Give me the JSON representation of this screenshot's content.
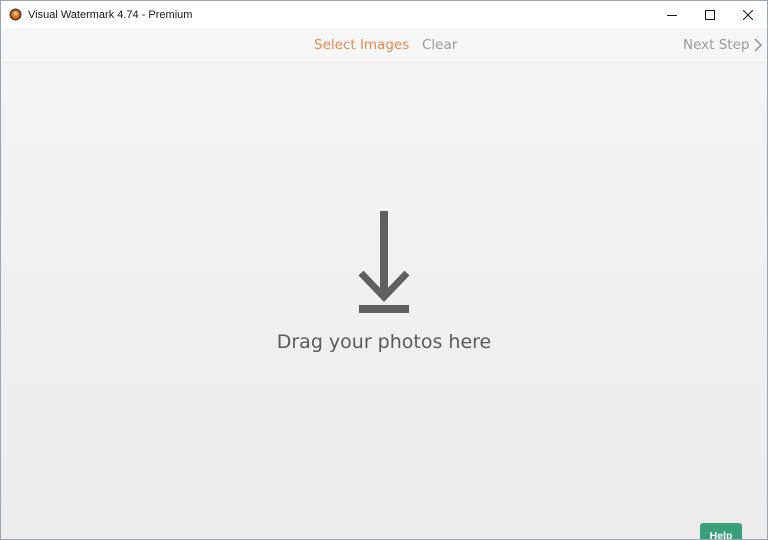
{
  "window": {
    "title": "Visual Watermark 4.74 - Premium",
    "controls": {
      "minimize": "minimize-icon",
      "maximize": "maximize-icon",
      "close": "close-icon"
    }
  },
  "toolbar": {
    "select_images": "Select Images",
    "clear": "Clear",
    "next_step": "Next Step"
  },
  "dropzone": {
    "label": "Drag your photos here",
    "icon": "download-arrow-icon"
  },
  "help": {
    "label": "Help"
  },
  "colors": {
    "accent": "#e58a4e",
    "muted": "#9a9a9a",
    "help_bg": "#3aa07a",
    "icon": "#606060"
  }
}
